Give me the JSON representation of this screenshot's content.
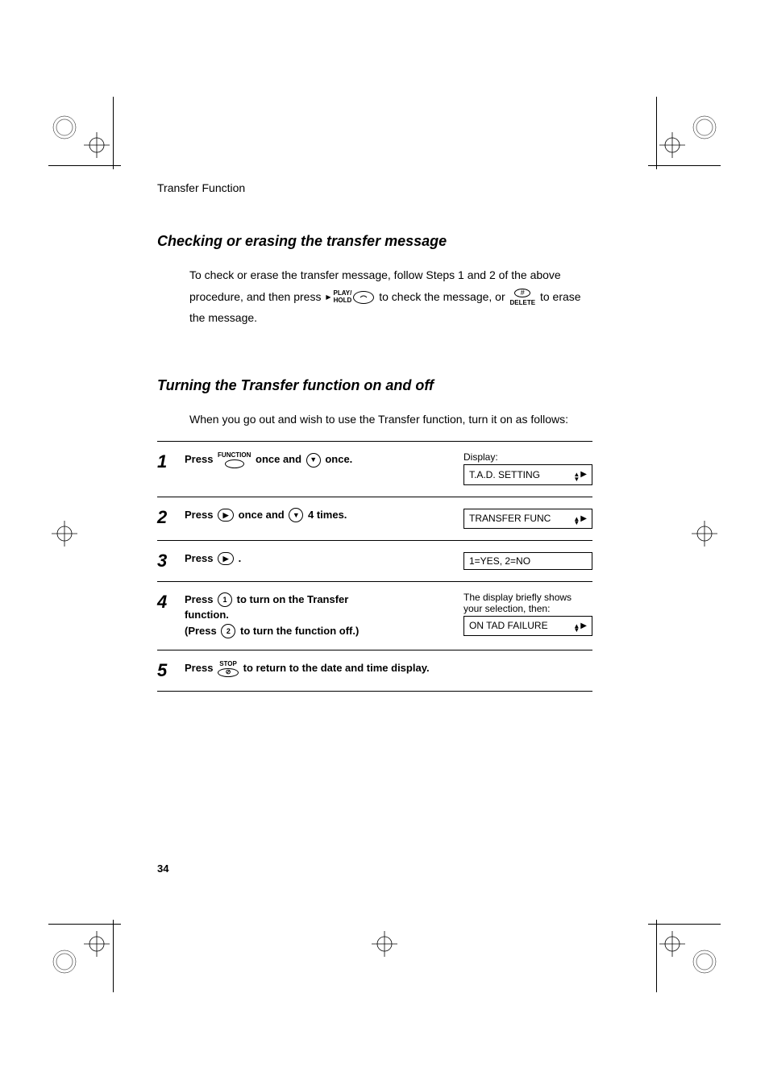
{
  "running_head": "Transfer Function",
  "section1": {
    "title": "Checking or erasing the transfer message",
    "para1_a": "To check or erase the transfer message, follow Steps 1 and 2 of the above",
    "para1_b": "procedure, and then press",
    "para1_c": "to check the message, or",
    "para1_d": "to erase",
    "para1_e": "the message."
  },
  "play_hold_top": "PLAY/",
  "play_hold_bottom": "HOLD",
  "delete_label": "DELETE",
  "hash_symbol": "#",
  "section2": {
    "title": "Turning the Transfer function on and off",
    "intro": "When you go out and wish to use the Transfer function, turn it on as follows:"
  },
  "display_word": "Display:",
  "function_label": "FUNCTION",
  "stop_label": "STOP",
  "steps": [
    {
      "num": "1",
      "text_a": "Press",
      "text_b": "once and",
      "text_c": "once.",
      "lcd": "T.A.D. SETTING",
      "show_display_word": true,
      "lcd_arrows": true
    },
    {
      "num": "2",
      "text_a": "Press",
      "text_b": "once and",
      "text_c": "4 times.",
      "lcd": "TRANSFER FUNC",
      "lcd_arrows": true
    },
    {
      "num": "3",
      "text_a": "Press",
      "text_dot": ".",
      "lcd": "1=YES, 2=NO",
      "lcd_arrows": false
    },
    {
      "num": "4",
      "text_a": "Press",
      "text_b": "to turn on the Transfer",
      "text_c": "function.",
      "text_d": "(Press",
      "text_e": "to turn the function off.)",
      "pre_lcd_note": "The display briefly shows your selection, then:",
      "lcd": "ON TAD FAILURE",
      "lcd_arrows": true
    },
    {
      "num": "5",
      "text_a": "Press",
      "text_b": "to return to the date and time display."
    }
  ],
  "page_number": "34"
}
